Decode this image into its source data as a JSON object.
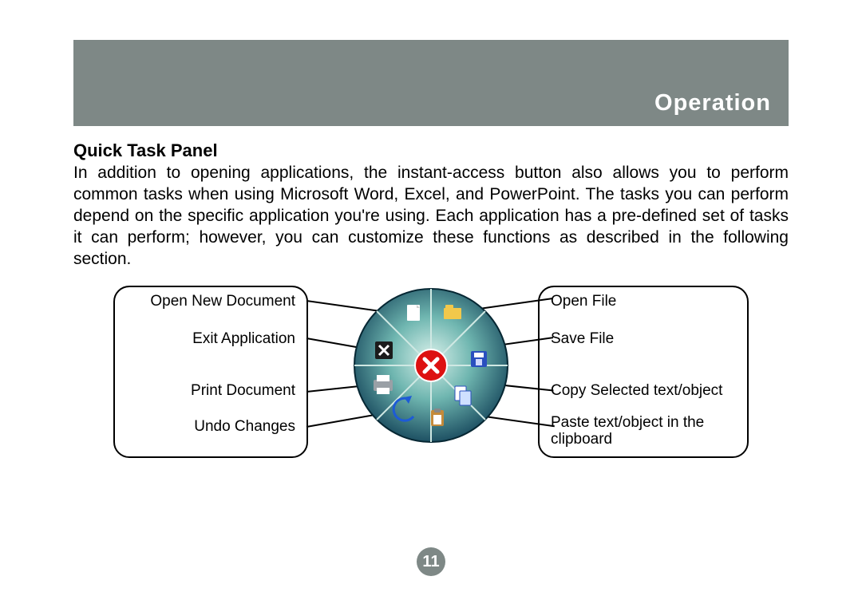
{
  "header": {
    "title": "Operation"
  },
  "section": {
    "title": "Quick Task Panel"
  },
  "body": {
    "paragraph": "In addition to opening applications, the instant-access button also allows you to perform common tasks when using Microsoft Word, Excel, and PowerPoint. The tasks you can perform depend on the specific application you're using. Each application has a pre-defined set of tasks it can perform; however, you can customize these functions as described in the following section."
  },
  "diagram": {
    "left_labels": {
      "open_new_document": "Open New Document",
      "exit_application": "Exit Application",
      "print_document": "Print Document",
      "undo_changes": "Undo Changes"
    },
    "right_labels": {
      "open_file": "Open File",
      "save_file": "Save File",
      "copy": "Copy Selected text/object",
      "paste": "Paste text/object in the clipboard"
    },
    "wheel_segments": [
      "new-document-icon",
      "open-file-icon",
      "save-file-icon",
      "copy-icon",
      "paste-icon",
      "undo-icon",
      "print-icon",
      "exit-icon"
    ],
    "center": "close-icon"
  },
  "page_number": "11"
}
